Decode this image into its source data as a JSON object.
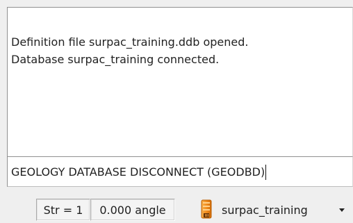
{
  "output": {
    "lines": [
      "Definition file surpac_training.ddb opened.",
      "Database surpac_training connected."
    ]
  },
  "command": {
    "value": "GEOLOGY DATABASE DISCONNECT (GEODBD)"
  },
  "status_bar": {
    "string_field": "Str = 1",
    "angle_field": "0.000 angle",
    "database": {
      "label": "surpac_training",
      "icon": "database-icon"
    },
    "dropdown_icon": "chevron-down-icon"
  },
  "colors": {
    "icon_orange": "#f08a1c",
    "icon_dark": "#9a4d00",
    "text": "#222222",
    "panel_bg": "#efefef",
    "output_bg": "#ffffff"
  }
}
